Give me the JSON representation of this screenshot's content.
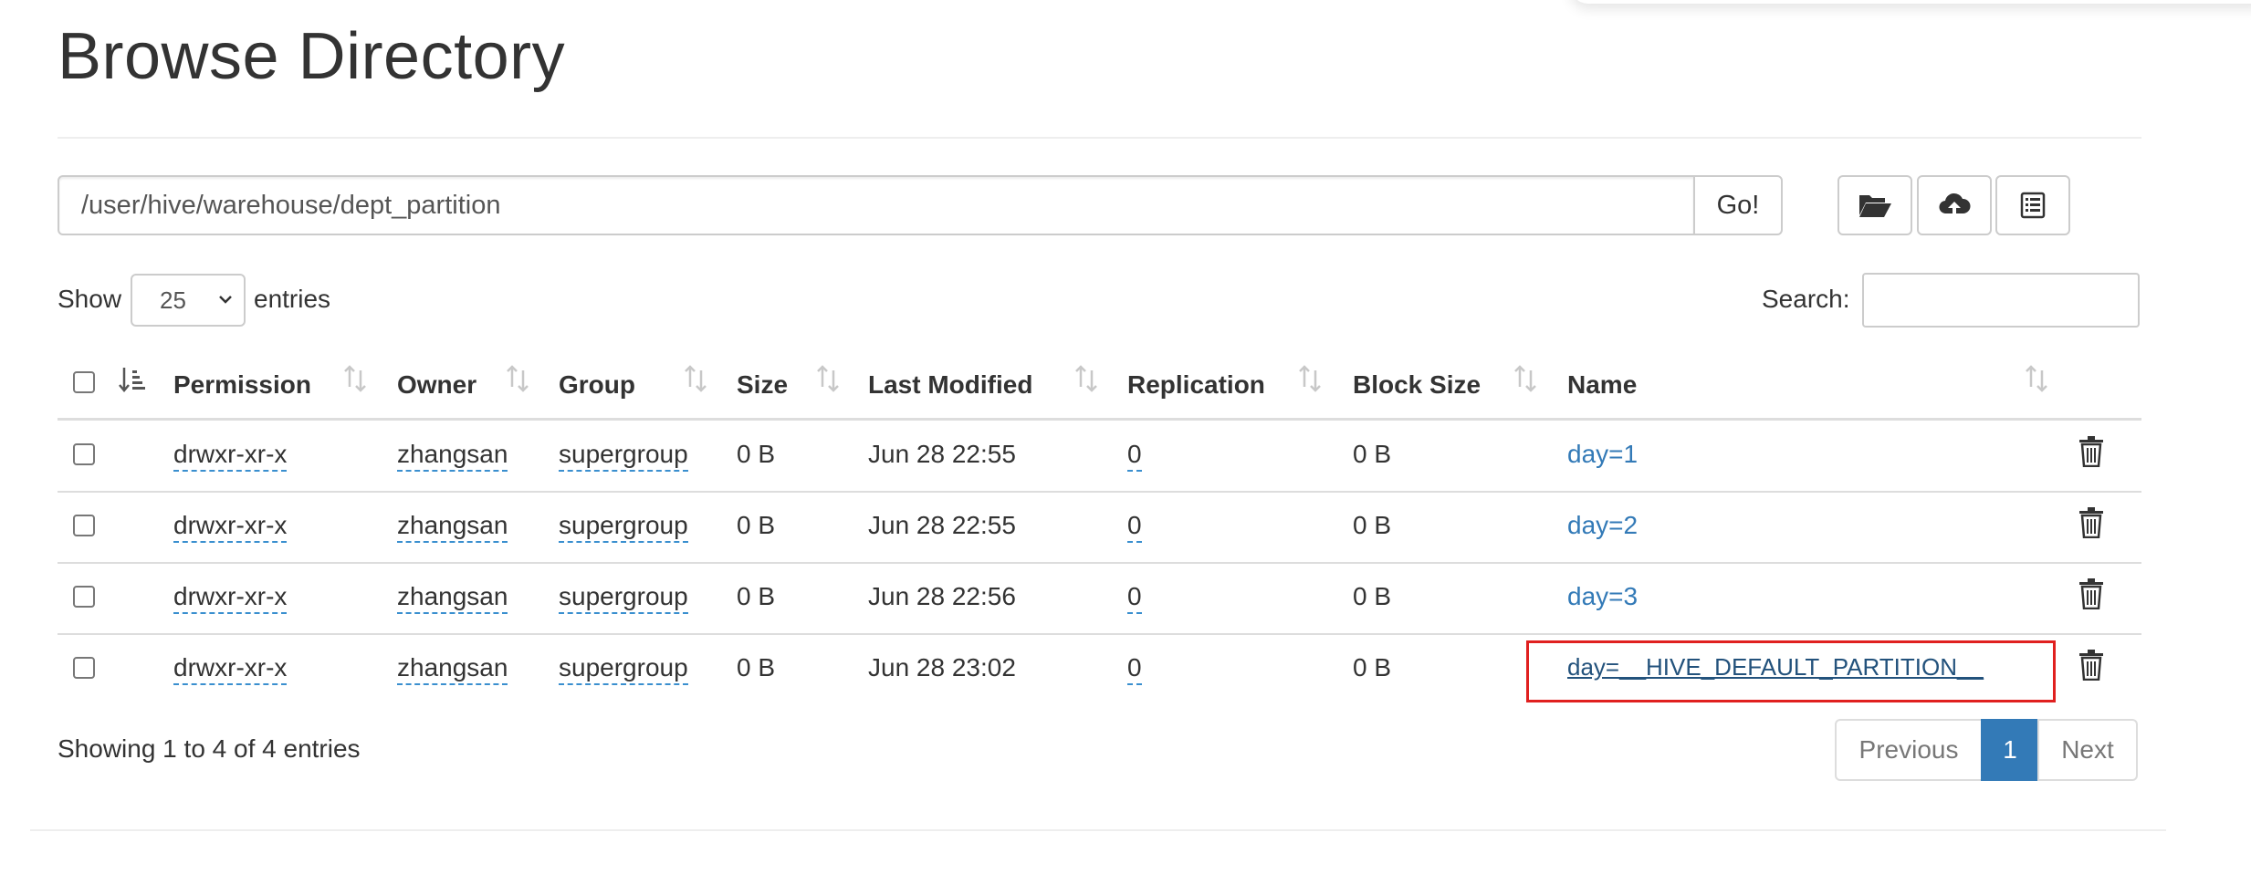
{
  "page": {
    "title": "Browse Directory"
  },
  "toolbar": {
    "path_value": "/user/hive/warehouse/dept_partition",
    "go_label": "Go!",
    "icons": [
      "folder-open-icon",
      "cloud-upload-icon",
      "list-icon"
    ]
  },
  "entries": {
    "show_label": "Show",
    "selected": "25",
    "entries_label": "entries"
  },
  "search": {
    "label": "Search:",
    "value": ""
  },
  "table": {
    "columns": [
      "Permission",
      "Owner",
      "Group",
      "Size",
      "Last Modified",
      "Replication",
      "Block Size",
      "Name"
    ],
    "rows": [
      {
        "permission": "drwxr-xr-x",
        "owner": "zhangsan",
        "group": "supergroup",
        "size": "0 B",
        "modified": "Jun 28 22:55",
        "replication": "0",
        "block_size": "0 B",
        "name": "day=1"
      },
      {
        "permission": "drwxr-xr-x",
        "owner": "zhangsan",
        "group": "supergroup",
        "size": "0 B",
        "modified": "Jun 28 22:55",
        "replication": "0",
        "block_size": "0 B",
        "name": "day=2"
      },
      {
        "permission": "drwxr-xr-x",
        "owner": "zhangsan",
        "group": "supergroup",
        "size": "0 B",
        "modified": "Jun 28 22:56",
        "replication": "0",
        "block_size": "0 B",
        "name": "day=3"
      },
      {
        "permission": "drwxr-xr-x",
        "owner": "zhangsan",
        "group": "supergroup",
        "size": "0 B",
        "modified": "Jun 28 23:02",
        "replication": "0",
        "block_size": "0 B",
        "name": "day=__HIVE_DEFAULT_PARTITION__"
      }
    ]
  },
  "footer": {
    "showing": "Showing 1 to 4 of 4 entries",
    "pagination": {
      "previous": "Previous",
      "current": "1",
      "next": "Next"
    }
  },
  "colors": {
    "link": "#337ab7",
    "active_page": "#337ab7",
    "highlight": "#e0201f"
  }
}
